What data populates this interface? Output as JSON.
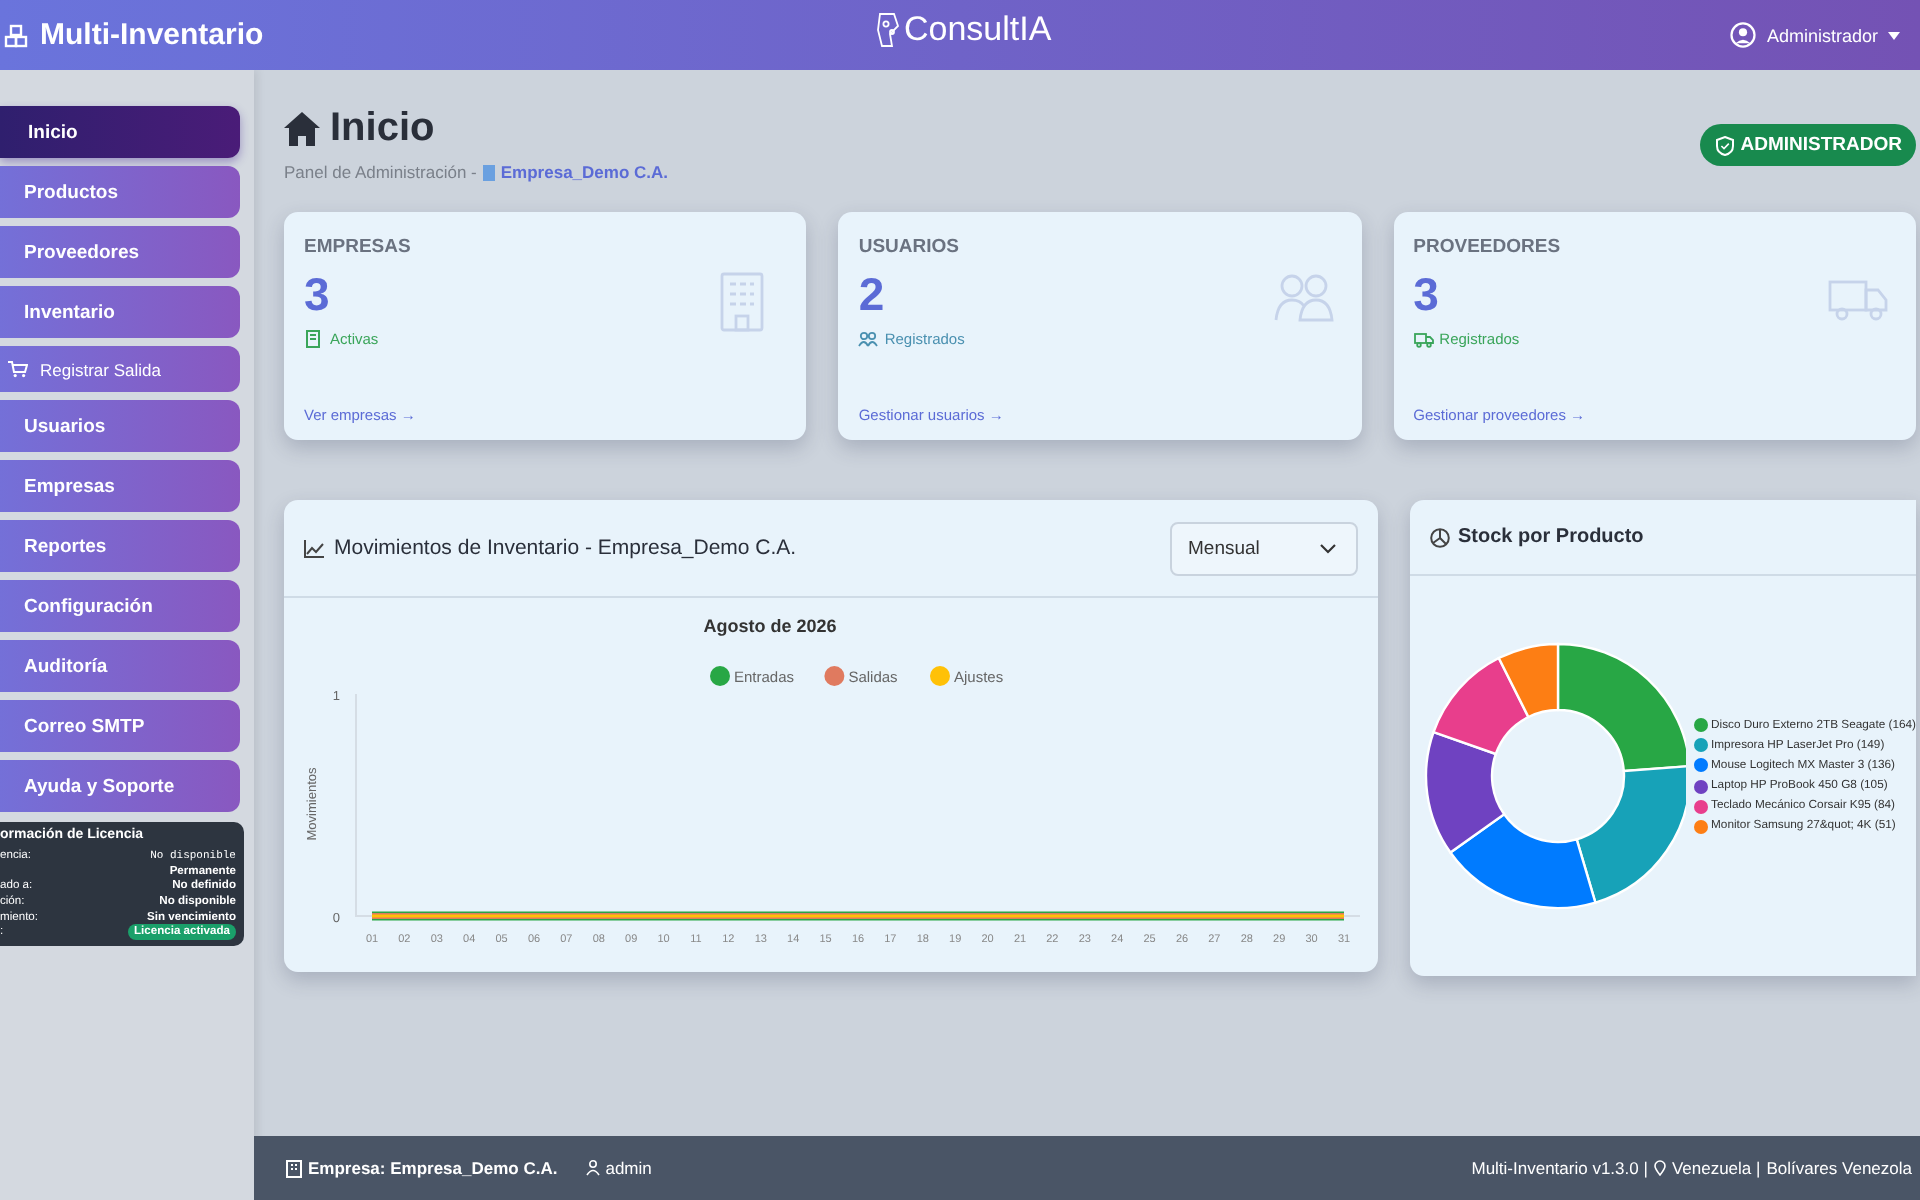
{
  "header": {
    "app_title": "Multi-Inventario",
    "logo": "ConsultIA",
    "user": "Administrador"
  },
  "sidebar": {
    "items": [
      {
        "label": "Inicio",
        "selected": true,
        "kind": "main"
      },
      {
        "label": "Productos",
        "selected": false,
        "kind": "main"
      },
      {
        "label": "Proveedores",
        "selected": false,
        "kind": "main"
      },
      {
        "label": "Inventario",
        "selected": false,
        "kind": "main"
      },
      {
        "label": "Registrar Salida",
        "selected": false,
        "kind": "sub"
      },
      {
        "label": "Usuarios",
        "selected": false,
        "kind": "main"
      },
      {
        "label": "Empresas",
        "selected": false,
        "kind": "main"
      },
      {
        "label": "Reportes",
        "selected": false,
        "kind": "main"
      },
      {
        "label": "Configuración",
        "selected": false,
        "kind": "main"
      },
      {
        "label": "Auditoría",
        "selected": false,
        "kind": "main"
      },
      {
        "label": "Correo SMTP",
        "selected": false,
        "kind": "main"
      },
      {
        "label": "Ayuda y Soporte",
        "selected": false,
        "kind": "main"
      }
    ]
  },
  "license": {
    "title": "ormación de Licencia",
    "rows": [
      {
        "label": "encia:",
        "value": "No disponible",
        "kind": "mono"
      },
      {
        "value": "Permanente",
        "kind": "bold"
      },
      {
        "label": "ado a:",
        "value": "No definido",
        "kind": "bold"
      },
      {
        "label": "ción:",
        "value": "No disponible",
        "kind": "bold"
      },
      {
        "label": "miento:",
        "value": "Sin vencimiento",
        "kind": "bold"
      },
      {
        "label": ":",
        "value": "Licencia activada",
        "kind": "badge"
      }
    ]
  },
  "page": {
    "title": "Inicio",
    "breadcrumb": "Panel de Administración -",
    "company": "Empresa_Demo C.A.",
    "role_badge": "ADMINISTRADOR"
  },
  "stats": [
    {
      "kind": "companies",
      "title": "EMPRESAS",
      "value": "3",
      "note": "Activas",
      "link": "Ver empresas →"
    },
    {
      "kind": "users",
      "title": "USUARIOS",
      "value": "2",
      "note": "Registrados",
      "link": "Gestionar usuarios →"
    },
    {
      "kind": "suppliers",
      "title": "PROVEEDORES",
      "value": "3",
      "note": "Registrados",
      "link": "Gestionar proveedores →"
    }
  ],
  "movements": {
    "title": "Movimientos de Inventario - Empresa_Demo C.A.",
    "period": "Mensual",
    "chart_data": {
      "type": "line",
      "title": "Agosto de 2026",
      "ylabel": "Movimientos",
      "categories": [
        "01",
        "02",
        "03",
        "04",
        "05",
        "06",
        "07",
        "08",
        "09",
        "10",
        "11",
        "12",
        "13",
        "14",
        "15",
        "16",
        "17",
        "18",
        "19",
        "20",
        "21",
        "22",
        "23",
        "24",
        "25",
        "26",
        "27",
        "28",
        "29",
        "30",
        "31"
      ],
      "ylim": [
        0,
        1
      ],
      "yticks": [
        0,
        1
      ],
      "legend": "top",
      "series": [
        {
          "name": "Entradas",
          "color": "#28a745",
          "values": [
            0,
            0,
            0,
            0,
            0,
            0,
            0,
            0,
            0,
            0,
            0,
            0,
            0,
            0,
            0,
            0,
            0,
            0,
            0,
            0,
            0,
            0,
            0,
            0,
            0,
            0,
            0,
            0,
            0,
            0,
            0
          ]
        },
        {
          "name": "Salidas",
          "color": "#e07a5f",
          "values": [
            0,
            0,
            0,
            0,
            0,
            0,
            0,
            0,
            0,
            0,
            0,
            0,
            0,
            0,
            0,
            0,
            0,
            0,
            0,
            0,
            0,
            0,
            0,
            0,
            0,
            0,
            0,
            0,
            0,
            0,
            0
          ]
        },
        {
          "name": "Ajustes",
          "color": "#ffc107",
          "values": [
            0,
            0,
            0,
            0,
            0,
            0,
            0,
            0,
            0,
            0,
            0,
            0,
            0,
            0,
            0,
            0,
            0,
            0,
            0,
            0,
            0,
            0,
            0,
            0,
            0,
            0,
            0,
            0,
            0,
            0,
            0
          ]
        }
      ]
    }
  },
  "stock": {
    "title": "Stock por Producto",
    "chart_data": {
      "type": "donut",
      "categories": [
        "Disco Duro Externo 2TB Seagate (164)",
        "Impresora HP LaserJet Pro (149)",
        "Mouse Logitech MX Master 3 (136)",
        "Laptop HP ProBook 450 G8 (105)",
        "Teclado Mecánico Corsair K95 (84)",
        "Monitor Samsung 27&quot; 4K (51)"
      ],
      "values": [
        164,
        149,
        136,
        105,
        84,
        51
      ],
      "colors": [
        "#28a745",
        "#17a2b8",
        "#007bff",
        "#6f42c1",
        "#e83e8c",
        "#fd7e14"
      ]
    }
  },
  "footer": {
    "company": "Empresa: Empresa_Demo C.A.",
    "user": "admin",
    "version": "Multi-Inventario v1.3.0 |",
    "country": "Venezuela |",
    "currency": "Bolívares Venezola"
  }
}
